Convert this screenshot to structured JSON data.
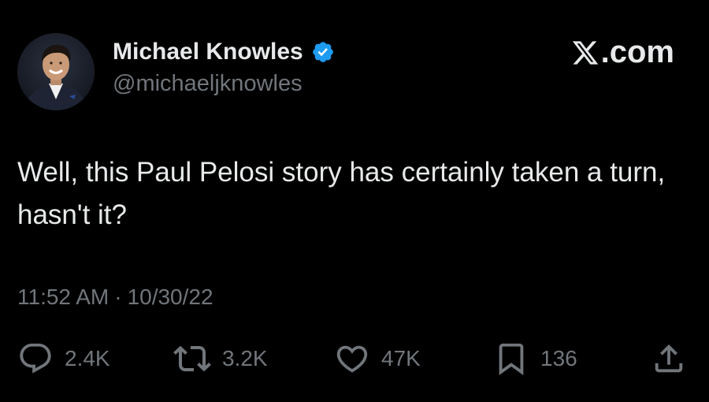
{
  "author": {
    "display_name": "Michael Knowles",
    "handle": "@michaeljknowles",
    "verified": true
  },
  "brand": {
    "label": ".com",
    "icon": "x-logo-icon"
  },
  "tweet": {
    "text": "Well, this Paul Pelosi story has certainly taken a turn, hasn't it?",
    "time": "11:52 AM",
    "separator": "·",
    "date": "10/30/22"
  },
  "metrics": {
    "replies": "2.4K",
    "reposts": "3.2K",
    "likes": "47K",
    "bookmarks": "136"
  },
  "icons": {
    "reply": "reply-icon",
    "repost": "repost-icon",
    "like": "heart-icon",
    "bookmark": "bookmark-icon",
    "share": "share-icon",
    "verified": "verified-badge-icon"
  },
  "colors": {
    "background": "#000000",
    "text": "#e7e9ea",
    "secondary": "#71767b",
    "verified": "#1d9bf0"
  }
}
